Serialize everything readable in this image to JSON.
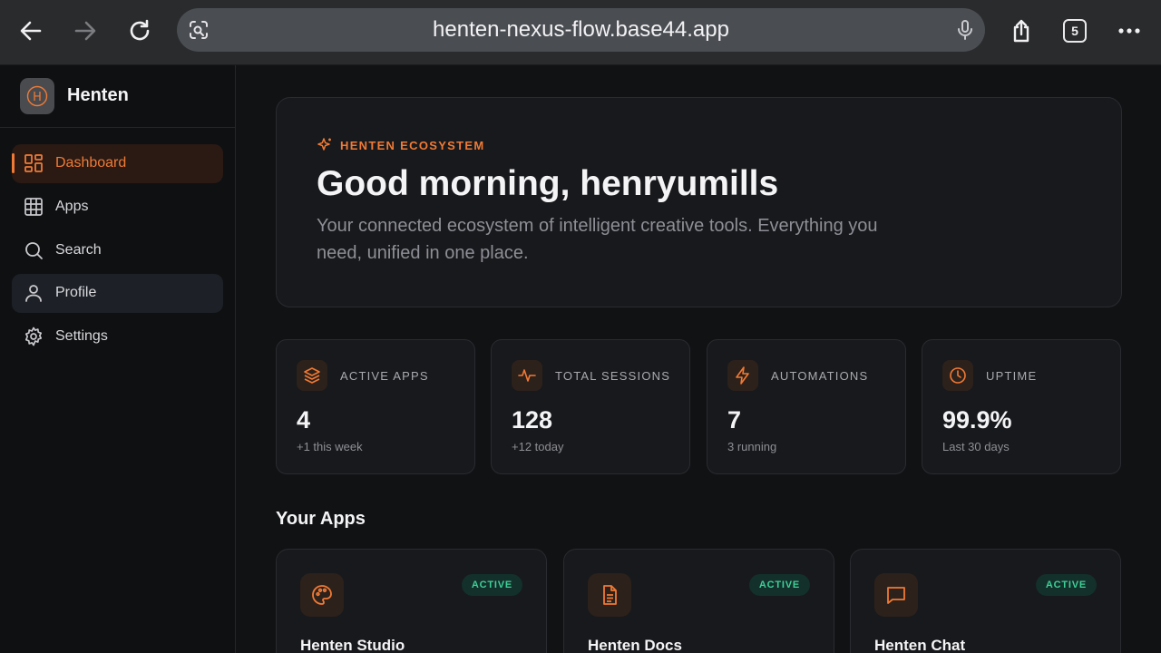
{
  "browser": {
    "url": "henten-nexus-flow.base44.app",
    "tab_count": "5"
  },
  "brand": {
    "name": "Henten",
    "logo_letter": "H"
  },
  "sidebar": {
    "items": [
      {
        "label": "Dashboard",
        "icon": "dashboard-icon",
        "state": "active"
      },
      {
        "label": "Apps",
        "icon": "grid-icon",
        "state": "normal"
      },
      {
        "label": "Search",
        "icon": "search-icon",
        "state": "normal"
      },
      {
        "label": "Profile",
        "icon": "user-icon",
        "state": "hover"
      },
      {
        "label": "Settings",
        "icon": "gear-icon",
        "state": "normal"
      }
    ]
  },
  "hero": {
    "eyebrow": "HENTEN ECOSYSTEM",
    "title": "Good morning, henryumills",
    "subtitle": "Your connected ecosystem of intelligent creative tools. Everything you need, unified in one place."
  },
  "stats": [
    {
      "label": "ACTIVE APPS",
      "value": "4",
      "note": "+1 this week",
      "icon": "layers-icon"
    },
    {
      "label": "TOTAL SESSIONS",
      "value": "128",
      "note": "+12 today",
      "icon": "activity-icon"
    },
    {
      "label": "AUTOMATIONS",
      "value": "7",
      "note": "3 running",
      "icon": "lightning-icon"
    },
    {
      "label": "UPTIME",
      "value": "99.9%",
      "note": "Last 30 days",
      "icon": "clock-icon"
    }
  ],
  "apps_section": {
    "title": "Your Apps",
    "apps": [
      {
        "name": "Henten Studio",
        "badge": "ACTIVE",
        "icon": "palette-icon"
      },
      {
        "name": "Henten Docs",
        "badge": "ACTIVE",
        "icon": "document-icon"
      },
      {
        "name": "Henten Chat",
        "badge": "ACTIVE",
        "icon": "chat-icon"
      }
    ]
  },
  "colors": {
    "accent": "#f07a35",
    "background": "#111214",
    "card": "#18191c",
    "badge_text": "#3fcf98"
  }
}
